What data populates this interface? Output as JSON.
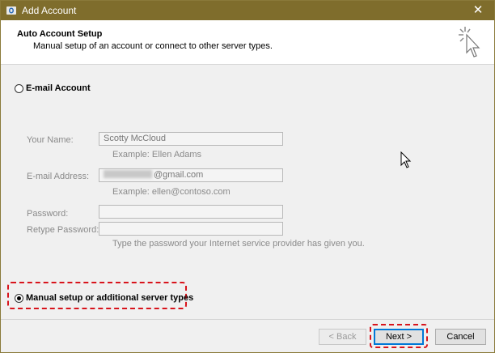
{
  "window": {
    "title": "Add Account",
    "close_glyph": "✕",
    "titlebar_color": "#7f6d2c"
  },
  "header": {
    "title": "Auto Account Setup",
    "subtitle": "Manual setup of an account or connect to other server types.",
    "icon": "wizard-cursor-icon"
  },
  "email_option": {
    "label": "E-mail Account",
    "selected": false
  },
  "form": {
    "name_label": "Your Name:",
    "name_value": "Scotty McCloud",
    "name_example": "Example: Ellen Adams",
    "email_label": "E-mail Address:",
    "email_value_visible": "@gmail.com",
    "email_example": "Example: ellen@contoso.com",
    "password_label": "Password:",
    "password_value": "",
    "retype_label": "Retype Password:",
    "retype_value": "",
    "password_hint": "Type the password your Internet service provider has given you."
  },
  "manual_option": {
    "label": "Manual setup or additional server types",
    "selected": true
  },
  "buttons": {
    "back": "< Back",
    "next": "Next >",
    "cancel": "Cancel"
  },
  "colors": {
    "highlight": "#d8141c",
    "focus": "#0078d7"
  }
}
